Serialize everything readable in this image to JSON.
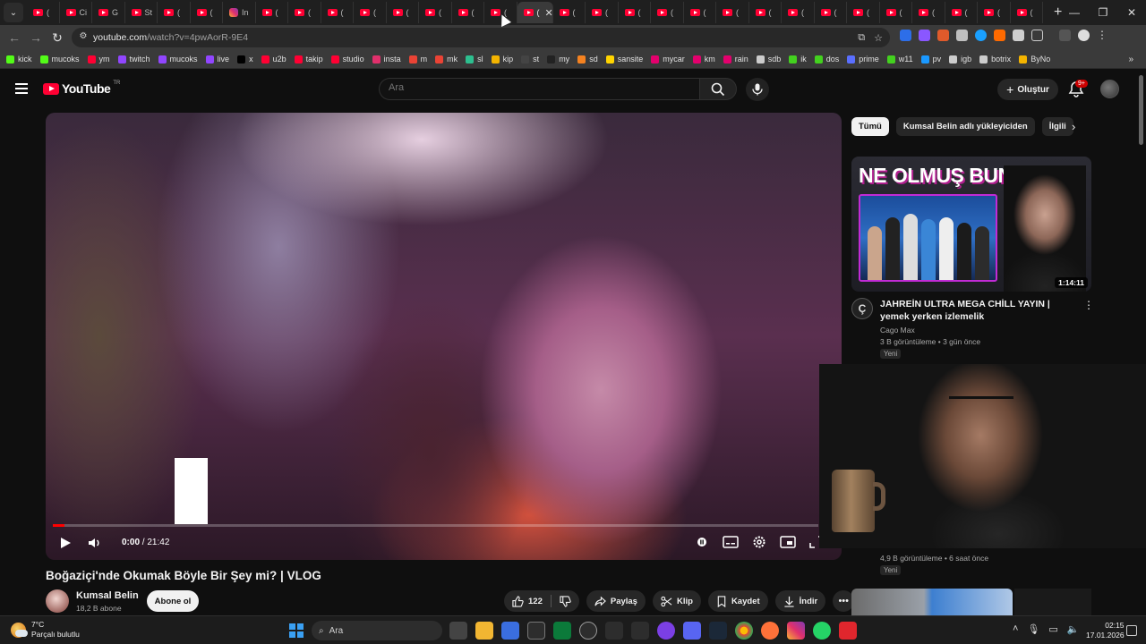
{
  "browser": {
    "tab_labels": [
      "(",
      "Ci",
      "G",
      "St",
      "(",
      "(",
      "In",
      "(",
      "(",
      "(",
      "(",
      "(",
      "(",
      "(",
      "(",
      "(",
      "(",
      "(",
      "(",
      "(",
      "(",
      "(",
      "(",
      "(",
      "(",
      "(",
      "(",
      "(",
      "(",
      "(",
      "("
    ],
    "address": {
      "host": "youtube.com",
      "path": "/watch?v=4pwAorR-9E4"
    },
    "bookmarks": [
      {
        "label": "kick",
        "color": "#53fc18"
      },
      {
        "label": "mucoks",
        "color": "#53fc18"
      },
      {
        "label": "ym",
        "color": "#ff0033"
      },
      {
        "label": "twitch",
        "color": "#9146ff"
      },
      {
        "label": "mucoks",
        "color": "#9146ff"
      },
      {
        "label": "live",
        "color": "#9146ff"
      },
      {
        "label": "x",
        "color": "#000000"
      },
      {
        "label": "u2b",
        "color": "#ff0033"
      },
      {
        "label": "takip",
        "color": "#ff0033"
      },
      {
        "label": "studio",
        "color": "#ff0033"
      },
      {
        "label": "insta",
        "color": "#e1306c"
      },
      {
        "label": "m",
        "color": "#ea4335"
      },
      {
        "label": "mk",
        "color": "#ea4335"
      },
      {
        "label": "sl",
        "color": "#2dbf8f"
      },
      {
        "label": "kip",
        "color": "#f4b400"
      },
      {
        "label": "st",
        "color": "#444444"
      },
      {
        "label": "my",
        "color": "#222222"
      },
      {
        "label": "sd",
        "color": "#f58220"
      },
      {
        "label": "sansite",
        "color": "#ffd400"
      },
      {
        "label": "mycar",
        "color": "#e3006d"
      },
      {
        "label": "km",
        "color": "#e3006d"
      },
      {
        "label": "rain",
        "color": "#e3006d"
      },
      {
        "label": "sdb",
        "color": "#cccccc"
      },
      {
        "label": "ik",
        "color": "#43d11f"
      },
      {
        "label": "dos",
        "color": "#43d11f"
      },
      {
        "label": "prime",
        "color": "#5a6fff"
      },
      {
        "label": "w11",
        "color": "#43d11f"
      },
      {
        "label": "pv",
        "color": "#1a98ff"
      },
      {
        "label": "igb",
        "color": "#cccccc"
      },
      {
        "label": "botrix",
        "color": "#cccccc"
      },
      {
        "label": "ByNo",
        "color": "#f4b400"
      }
    ]
  },
  "header": {
    "logo_text": "YouTube",
    "region": "TR",
    "search_placeholder": "Ara",
    "create_label": "Oluştur",
    "notif_count": "9+"
  },
  "player": {
    "time_current": "0:00",
    "time_total": "21:42",
    "progress": 0.015
  },
  "video": {
    "title": "Boğaziçi'nde Okumak Böyle Bir Şey mi? | VLOG",
    "channel": "Kumsal Belin",
    "subscribers": "18,2 B abone",
    "subscribe_label": "Abone ol",
    "likes": "122",
    "share_label": "Paylaş",
    "clip_label": "Klip",
    "save_label": "Kaydet",
    "download_label": "İndir"
  },
  "sidebar": {
    "chips": [
      "Tümü",
      "Kumsal Belin adlı yükleyiciden",
      "İlgili"
    ],
    "recommendations": [
      {
        "thumb_text": "NE OLMUŞ BUNA",
        "duration": "1:14:11",
        "title": "JAHREİN ULTRA MEGA CHİLL YAYIN | yemek yerken izlemelik",
        "channel": "Cago Max",
        "meta": "3 B görüntüleme • 3 gün önce",
        "badge": "Yeni"
      },
      {
        "meta": "4,9 B görüntüleme • 6 saat önce",
        "badge": "Yeni"
      }
    ]
  },
  "taskbar": {
    "temp": "7°C",
    "weather": "Parçalı bulutlu",
    "search_label": "Ara",
    "time": "02:15",
    "date": "17.01.2026"
  }
}
